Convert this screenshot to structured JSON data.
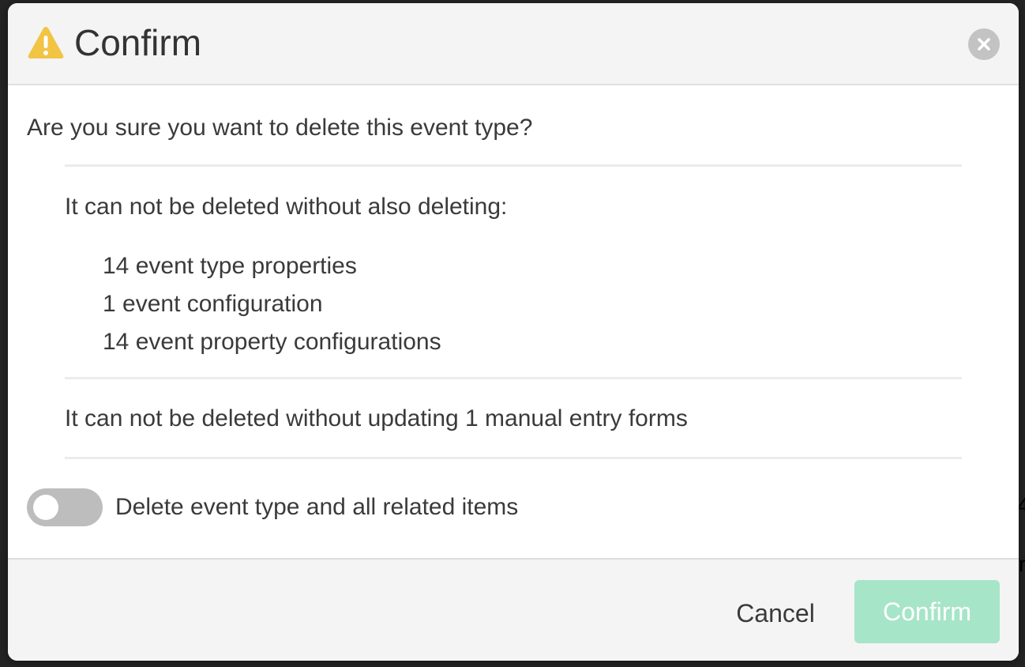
{
  "dialog": {
    "title": "Confirm",
    "icon": "warning-icon",
    "close_icon": "close-icon"
  },
  "body": {
    "question": "Are you sure you want to delete this event type?",
    "dependencies_intro": "It can not be deleted without also deleting:",
    "dependencies": [
      "14 event type properties",
      "1 event configuration",
      "14 event property configurations"
    ],
    "forms_notice": "It can not be deleted without updating 1 manual entry forms",
    "toggle": {
      "label": "Delete event type and all related items",
      "checked": false
    }
  },
  "footer": {
    "cancel_label": "Cancel",
    "confirm_label": "Confirm",
    "confirm_disabled": true
  },
  "colors": {
    "warning": "#f2c443",
    "confirm_disabled_bg": "#a6e5c8",
    "toggle_off": "#bdbdbd"
  }
}
